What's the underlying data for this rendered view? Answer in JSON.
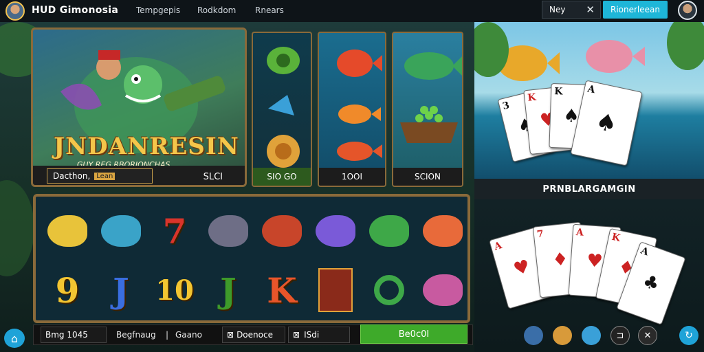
{
  "header": {
    "brand": "HUD Gimonosia",
    "nav": [
      "Tempgepis",
      "Rodkdom",
      "Rnears"
    ],
    "search_value": "Ney",
    "cta_label": "Rionerleean"
  },
  "hero": {
    "title": "JNDANRESIN",
    "subtitle": "GUY REG RBORIONCHAS",
    "button_label": "Dacthon,",
    "button_tag": "Lean",
    "value": "SLCI"
  },
  "tiles": [
    {
      "label": "SIO GO"
    },
    {
      "label": "1OOI"
    },
    {
      "label": "SCION"
    }
  ],
  "reels": {
    "row1": [
      "yellow-fish",
      "blue-fish",
      "seven",
      "grey-fish",
      "red-fish",
      "purple-fish",
      "green-fish",
      "orange-fish"
    ],
    "row2": [
      "9",
      "J",
      "10",
      "J",
      "K",
      "pirate",
      "green-chip",
      "pink-fish"
    ],
    "colors": {
      "9": "#f3c531",
      "J": "#3a6ee0",
      "10": "#f3c531",
      "K": "#e8552a",
      "seven": "#d9342b"
    }
  },
  "controls": {
    "bet": "Bmg 1045",
    "label1": "Begfnaug",
    "label2": "Gaano",
    "option": "Doenoce",
    "stat": "ISdi",
    "play_label": "Be0c0I"
  },
  "right_panel": {
    "title": "PRNBLARGAMGIN"
  },
  "cards_top": [
    {
      "rank": "3",
      "suit": "♠",
      "color": "#111"
    },
    {
      "rank": "K",
      "suit": "♥",
      "color": "#c22"
    },
    {
      "rank": "K",
      "suit": "♠",
      "color": "#111"
    },
    {
      "rank": "A",
      "suit": "♠",
      "color": "#111"
    }
  ],
  "cards_bottom": [
    {
      "rank": "A",
      "suit": "♥",
      "color": "#c22"
    },
    {
      "rank": "7",
      "suit": "♦",
      "color": "#c22"
    },
    {
      "rank": "A",
      "suit": "♥",
      "color": "#c22"
    },
    {
      "rank": "K",
      "suit": "♦",
      "color": "#c22"
    },
    {
      "rank": "A",
      "suit": "♣",
      "color": "#111"
    }
  ],
  "icons": {
    "home": "home-icon",
    "help": "help-icon",
    "close": "close-icon"
  }
}
